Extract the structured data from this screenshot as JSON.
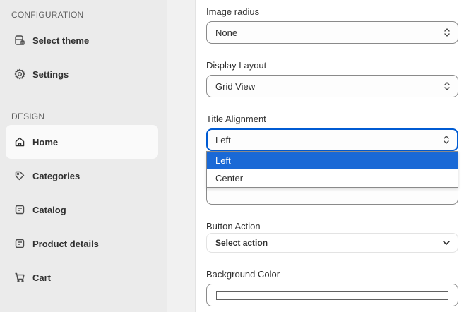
{
  "sidebar": {
    "configuration_heading": "CONFIGURATION",
    "design_heading": "DESIGN",
    "config_items": [
      {
        "label": "Select theme",
        "icon": "theme-icon"
      },
      {
        "label": "Settings",
        "icon": "gear-icon"
      }
    ],
    "design_items": [
      {
        "label": "Home",
        "icon": "home-icon",
        "active": true
      },
      {
        "label": "Categories",
        "icon": "tag-icon"
      },
      {
        "label": "Catalog",
        "icon": "catalog-icon"
      },
      {
        "label": "Product details",
        "icon": "product-icon"
      },
      {
        "label": "Cart",
        "icon": "cart-icon"
      }
    ]
  },
  "form": {
    "image_radius": {
      "label": "Image radius",
      "value": "None"
    },
    "display_layout": {
      "label": "Display Layout",
      "value": "Grid View"
    },
    "title_alignment": {
      "label": "Title Alignment",
      "value": "Left",
      "options": [
        "Left",
        "Center"
      ],
      "selected_index": 0
    },
    "button_action": {
      "label": "Button Action",
      "value": "Select action"
    },
    "background_color": {
      "label": "Background Color",
      "value_color": "#ffffff"
    }
  },
  "colors": {
    "focus_border": "#005bd3",
    "option_highlight": "#1a69d6",
    "sidebar_bg": "#ebebeb"
  }
}
